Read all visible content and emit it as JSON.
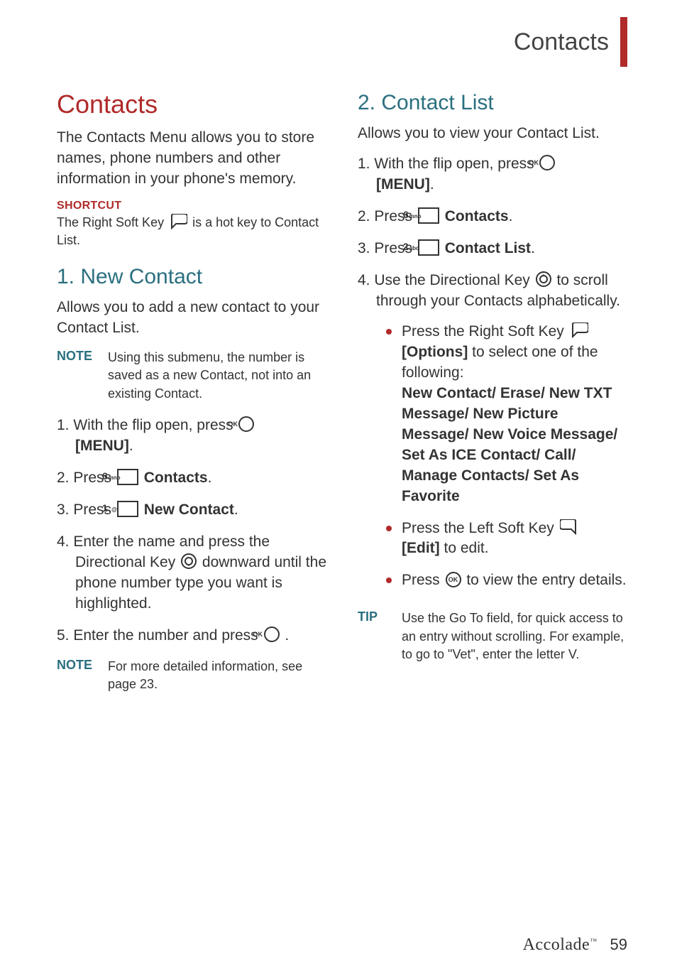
{
  "top_title": "Contacts",
  "left": {
    "heading": "Contacts",
    "intro": "The Contacts Menu allows you to store names, phone numbers and other information in your phone's memory.",
    "shortcut_label": "SHORTCUT",
    "shortcut_pre": "The Right Soft Key ",
    "shortcut_post": " is a hot key to Contact List.",
    "sec1_heading": "1. New Contact",
    "sec1_intro": "Allows you to add a new contact to your Contact List.",
    "note1_label": "NOTE",
    "note1_text": "Using this submenu, the number is saved as a new Contact, not into an existing Contact.",
    "step1_pre": "1. With the flip open, press  ",
    "step1_bold": "[MENU]",
    "step1_post": ".",
    "step2_pre": "2. Press  ",
    "step2_bold": "Contacts",
    "step2_post": ".",
    "step3_pre": "3. Press  ",
    "step3_bold": "New Contact",
    "step3_post": ".",
    "step4": "4. Enter the name and press the Directional Key  downward until the phone number type you want is highlighted.",
    "step4_pre": "4. Enter the name and press the Directional Key ",
    "step4_post": " downward until the phone number type you want is highlighted.",
    "step5_pre": "5. Enter the number and press  ",
    "step5_post": " .",
    "note2_label": "NOTE",
    "note2_text": "For more detailed information, see page 23.",
    "key6": {
      "main": "6",
      "sub": "mno"
    },
    "key1": {
      "main": "1",
      "sub": ""
    }
  },
  "right": {
    "sec2_heading": "2. Contact List",
    "sec2_intro": "Allows you to view your Contact List.",
    "step1_pre": "1. With the flip open, press  ",
    "step1_bold": "[MENU]",
    "step1_post": ".",
    "step2_pre": "2. Press  ",
    "step2_bold": "Contacts",
    "step2_post": ".",
    "step3_pre": "3. Press  ",
    "step3_bold": "Contact List",
    "step3_post": ".",
    "step4_pre": "4. Use the Directional Key ",
    "step4_post": " to scroll through your Contacts alphabetically.",
    "bul1_pre": "Press the Right Soft Key ",
    "bul1_bold1": "[Options]",
    "bul1_mid": " to select one of the following:",
    "bul1_bold2": "New Contact/ Erase/ New TXT Message/ New Picture Message/ New Voice Message/ Set As ICE Contact/ Call/  Manage Contacts/ Set As Favorite",
    "bul2_pre": "Press the Left Soft Key ",
    "bul2_bold": "[Edit]",
    "bul2_post": " to edit.",
    "bul3_pre": "Press  ",
    "bul3_post": " to view the entry details.",
    "tip_label": "TIP",
    "tip_text": "Use the Go To field, for quick access to an entry without scrolling.  For example, to go to \"Vet\", enter the letter V.",
    "key6": {
      "main": "6",
      "sub": "mno"
    },
    "key2": {
      "main": "2",
      "sub": "abc"
    }
  },
  "footer": {
    "brand": "Accolade",
    "tm": "™",
    "page": "59"
  }
}
